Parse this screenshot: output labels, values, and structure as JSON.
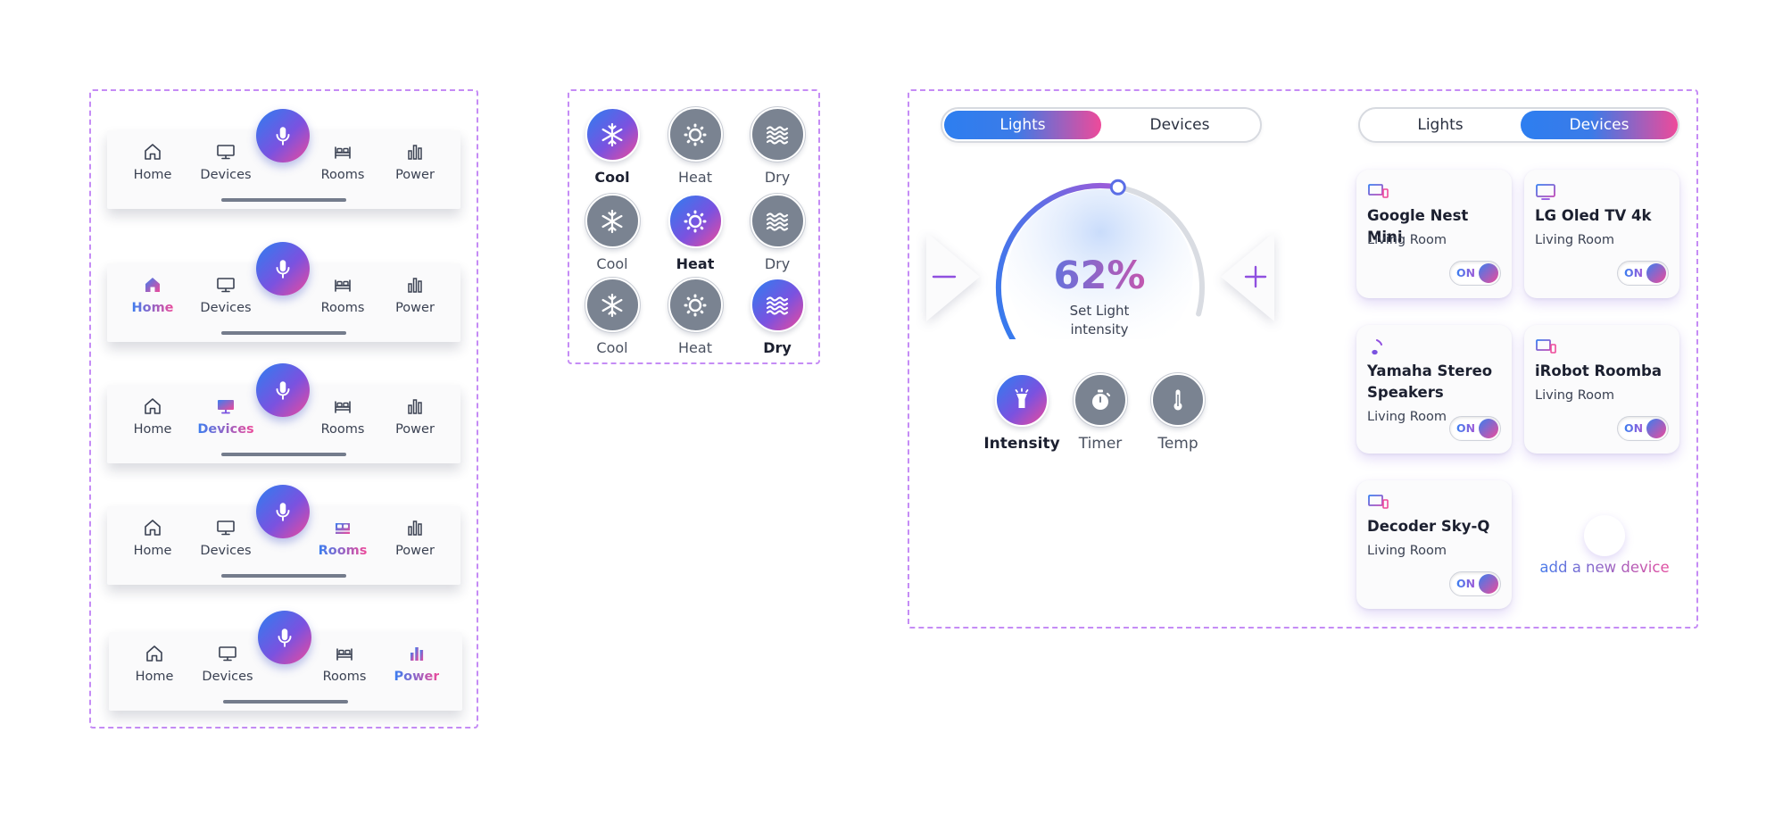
{
  "navbars": [
    {
      "items": [
        {
          "label": "Home",
          "icon": "home-icon",
          "active": false
        },
        {
          "label": "Devices",
          "icon": "monitor-icon",
          "active": false
        },
        {
          "label": "Rooms",
          "icon": "bed-icon",
          "active": false
        },
        {
          "label": "Power",
          "icon": "bar-chart-icon",
          "active": false
        }
      ]
    },
    {
      "items": [
        {
          "label": "Home",
          "icon": "home-icon",
          "active": true
        },
        {
          "label": "Devices",
          "icon": "monitor-icon",
          "active": false
        },
        {
          "label": "Rooms",
          "icon": "bed-icon",
          "active": false
        },
        {
          "label": "Power",
          "icon": "bar-chart-icon",
          "active": false
        }
      ]
    },
    {
      "items": [
        {
          "label": "Home",
          "icon": "home-icon",
          "active": false
        },
        {
          "label": "Devices",
          "icon": "monitor-icon",
          "active": true
        },
        {
          "label": "Rooms",
          "icon": "bed-icon",
          "active": false
        },
        {
          "label": "Power",
          "icon": "bar-chart-icon",
          "active": false
        }
      ]
    },
    {
      "items": [
        {
          "label": "Home",
          "icon": "home-icon",
          "active": false
        },
        {
          "label": "Devices",
          "icon": "monitor-icon",
          "active": false
        },
        {
          "label": "Rooms",
          "icon": "bed-icon",
          "active": true
        },
        {
          "label": "Power",
          "icon": "bar-chart-icon",
          "active": false
        }
      ]
    },
    {
      "items": [
        {
          "label": "Home",
          "icon": "home-icon",
          "active": false
        },
        {
          "label": "Devices",
          "icon": "monitor-icon",
          "active": false
        },
        {
          "label": "Rooms",
          "icon": "bed-icon",
          "active": false
        },
        {
          "label": "Power",
          "icon": "bar-chart-icon",
          "active": true
        }
      ]
    }
  ],
  "modes": [
    [
      {
        "label": "Cool",
        "icon": "snowflake-icon",
        "active": true
      },
      {
        "label": "Heat",
        "icon": "sun-icon",
        "active": false
      },
      {
        "label": "Dry",
        "icon": "waves-icon",
        "active": false
      }
    ],
    [
      {
        "label": "Cool",
        "icon": "snowflake-icon",
        "active": false
      },
      {
        "label": "Heat",
        "icon": "sun-icon",
        "active": true
      },
      {
        "label": "Dry",
        "icon": "waves-icon",
        "active": false
      }
    ],
    [
      {
        "label": "Cool",
        "icon": "snowflake-icon",
        "active": false
      },
      {
        "label": "Heat",
        "icon": "sun-icon",
        "active": false
      },
      {
        "label": "Dry",
        "icon": "waves-icon",
        "active": true
      }
    ]
  ],
  "tabs_left": {
    "lights": "Lights",
    "devices": "Devices",
    "active": "Lights"
  },
  "tabs_right": {
    "lights": "Lights",
    "devices": "Devices",
    "active": "Devices"
  },
  "dial": {
    "value_text": "62%",
    "value_fraction": 0.62,
    "label": "Set Light intensity"
  },
  "controls": [
    {
      "label": "Intensity",
      "icon": "flashlight-icon",
      "active": true
    },
    {
      "label": "Timer",
      "icon": "stopwatch-icon",
      "active": false
    },
    {
      "label": "Temp",
      "icon": "thermometer-icon",
      "active": false
    }
  ],
  "devices": [
    {
      "name": "Google Nest Mini",
      "room": "Living Room",
      "state": "ON",
      "icon": "devices-icon"
    },
    {
      "name": "LG Oled TV 4k",
      "room": "Living Room",
      "state": "ON",
      "icon": "tv-icon"
    },
    {
      "name": "Yamaha Stereo Speakers",
      "room": "Living Room",
      "state": "ON",
      "icon": "music-note-icon"
    },
    {
      "name": "iRobot Roomba",
      "room": "Living Room",
      "state": "ON",
      "icon": "devices-icon"
    },
    {
      "name": "Decoder Sky-Q",
      "room": "Living Room",
      "state": "ON",
      "icon": "devices-icon"
    }
  ],
  "add_device": {
    "label": "add a new device"
  },
  "colors": {
    "accent_blue": "#2d7ef0",
    "accent_pink": "#ee4a9a",
    "accent_purple": "#7a52e0",
    "inactive_gray": "#7a8391",
    "frame_dash": "#c58cf5"
  }
}
